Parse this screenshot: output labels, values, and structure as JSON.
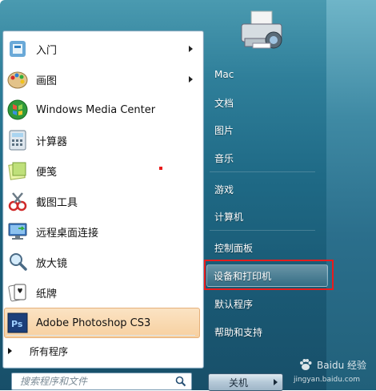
{
  "left_panel": {
    "programs": [
      {
        "label": "入门",
        "icon": "getting-started-icon",
        "has_submenu": true
      },
      {
        "label": "画图",
        "icon": "paint-icon",
        "has_submenu": true
      },
      {
        "label": "Windows Media Center",
        "icon": "media-center-icon",
        "has_submenu": false
      },
      {
        "label": "计算器",
        "icon": "calculator-icon",
        "has_submenu": false
      },
      {
        "label": "便笺",
        "icon": "sticky-notes-icon",
        "has_submenu": false
      },
      {
        "label": "截图工具",
        "icon": "snipping-tool-icon",
        "has_submenu": false
      },
      {
        "label": "远程桌面连接",
        "icon": "remote-desktop-icon",
        "has_submenu": false
      },
      {
        "label": "放大镜",
        "icon": "magnifier-icon",
        "has_submenu": false
      },
      {
        "label": "纸牌",
        "icon": "solitaire-icon",
        "has_submenu": false
      },
      {
        "label": "Adobe Photoshop CS3",
        "icon": "photoshop-icon",
        "has_submenu": false,
        "highlighted": true
      }
    ],
    "all_programs": "所有程序",
    "search": {
      "placeholder": "搜索程序和文件"
    }
  },
  "right_panel": {
    "items": [
      {
        "label": "Mac"
      },
      {
        "label": "文档"
      },
      {
        "label": "图片"
      },
      {
        "label": "音乐"
      },
      {
        "label": "游戏"
      },
      {
        "label": "计算机"
      },
      {
        "label": "控制面板"
      },
      {
        "label": "设备和打印机",
        "active": true
      },
      {
        "label": "默认程序"
      },
      {
        "label": "帮助和支持"
      }
    ],
    "shutdown_label": "关机"
  },
  "watermark": {
    "text": "Baidu 经验",
    "url": "jingyan.baidu.com"
  },
  "colors": {
    "accent_highlight": "#f7d0a0",
    "annotation_red": "#e81c1c",
    "frame_blue": "#1f6a86"
  }
}
